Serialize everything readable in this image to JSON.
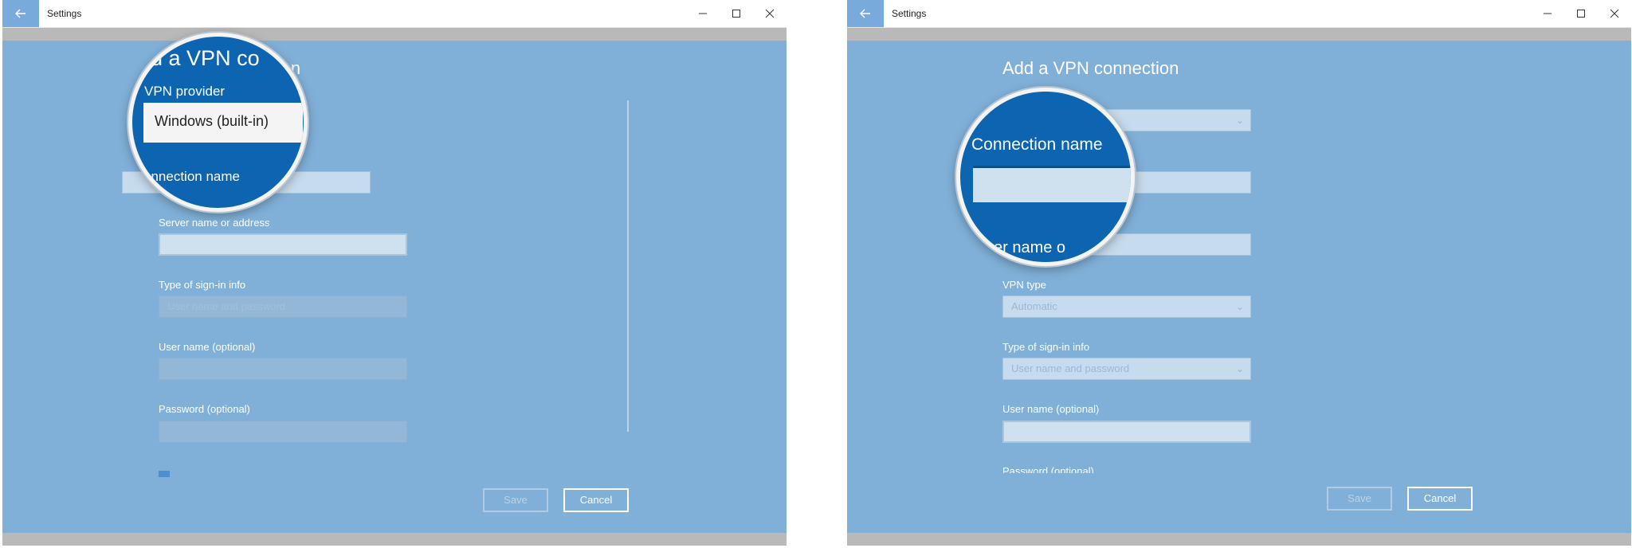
{
  "window_title": "Settings",
  "left": {
    "heading_before": "dd a VPN co",
    "heading_after": "nection",
    "magnifier": {
      "provider_label": "VPN provider",
      "provider_value": "Windows (built-in)",
      "connection_label": "onnection name"
    },
    "server_label": "Server name or address",
    "signin_label": "Type of sign-in info",
    "signin_value": "User name and password",
    "username_label": "User name (optional)",
    "password_label": "Password (optional)",
    "save_label": "Save",
    "cancel_label": "Cancel"
  },
  "right": {
    "heading": "Add a VPN connection",
    "magnifier": {
      "connection_label": "Connection name",
      "server_partial": "er name o"
    },
    "vpn_type_label": "VPN type",
    "vpn_type_value": "Automatic",
    "signin_label": "Type of sign-in info",
    "signin_value": "User name and password",
    "username_label": "User name (optional)",
    "password_label": "Password (optional)",
    "save_label": "Save",
    "cancel_label": "Cancel"
  },
  "icons": {
    "back": "back-arrow-icon",
    "minimize": "minimize-icon",
    "maximize": "maximize-icon",
    "close": "close-icon",
    "dropdown": "chevron-down-icon"
  },
  "colors": {
    "accent": "#0d64b0",
    "overlay": "#80b0d8",
    "back_button": "#79aadc"
  }
}
